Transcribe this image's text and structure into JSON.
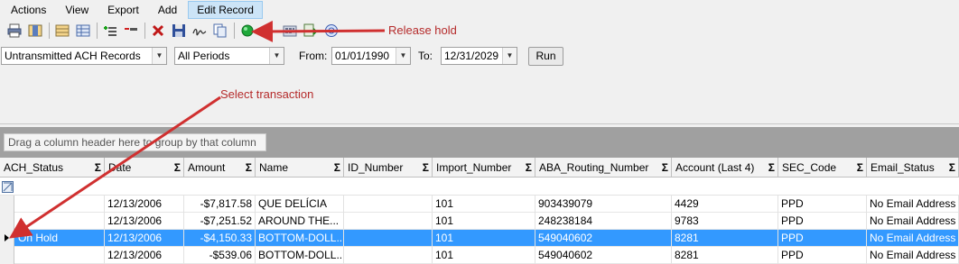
{
  "menu": {
    "items": [
      {
        "label": "Actions"
      },
      {
        "label": "View"
      },
      {
        "label": "Export"
      },
      {
        "label": "Add"
      },
      {
        "label": "Edit Record"
      }
    ]
  },
  "toolbar": {
    "icons": [
      "print-icon",
      "columns-icon",
      "grid-icon",
      "table-icon",
      "add-row-icon",
      "remove-row-icon",
      "delete-icon",
      "save-icon",
      "signature-icon",
      "copy-icon",
      "green-circle-icon",
      "calculator-icon",
      "export-icon",
      "info-icon"
    ]
  },
  "filters": {
    "record_type": "Untransmitted ACH Records",
    "period": "All Periods",
    "from_label": "From:",
    "from_date": "01/01/1990",
    "to_label": "To:",
    "to_date": "12/31/2029",
    "run_label": "Run"
  },
  "group_panel": {
    "hint": "Drag a column header here to group by that column"
  },
  "grid": {
    "columns": [
      "ACH_Status",
      "Date",
      "Amount",
      "Name",
      "ID_Number",
      "Import_Number",
      "ABA_Routing_Number",
      "Account (Last 4)",
      "SEC_Code",
      "Email_Status"
    ],
    "rows": [
      {
        "status": "",
        "date": "12/13/2006",
        "amount": "-$7,817.58",
        "name": "QUE DELÍCIA",
        "id": "",
        "import": "101",
        "aba": "903439079",
        "account": "4429",
        "sec": "PPD",
        "email": "No Email Address"
      },
      {
        "status": "",
        "date": "12/13/2006",
        "amount": "-$7,251.52",
        "name": "AROUND THE...",
        "id": "",
        "import": "101",
        "aba": "248238184",
        "account": "9783",
        "sec": "PPD",
        "email": "No Email Address"
      },
      {
        "status": "On Hold",
        "date": "12/13/2006",
        "amount": "-$4,150.33",
        "name": "BOTTOM-DOLL...",
        "id": "",
        "import": "101",
        "aba": "549040602",
        "account": "8281",
        "sec": "PPD",
        "email": "No Email Address"
      },
      {
        "status": "",
        "date": "12/13/2006",
        "amount": "-$539.06",
        "name": "BOTTOM-DOLL...",
        "id": "",
        "import": "101",
        "aba": "549040602",
        "account": "8281",
        "sec": "PPD",
        "email": "No Email Address"
      }
    ]
  },
  "annotations": {
    "release_hold": "Release hold",
    "select_transaction": "Select transaction",
    "color": "#c0392b"
  }
}
